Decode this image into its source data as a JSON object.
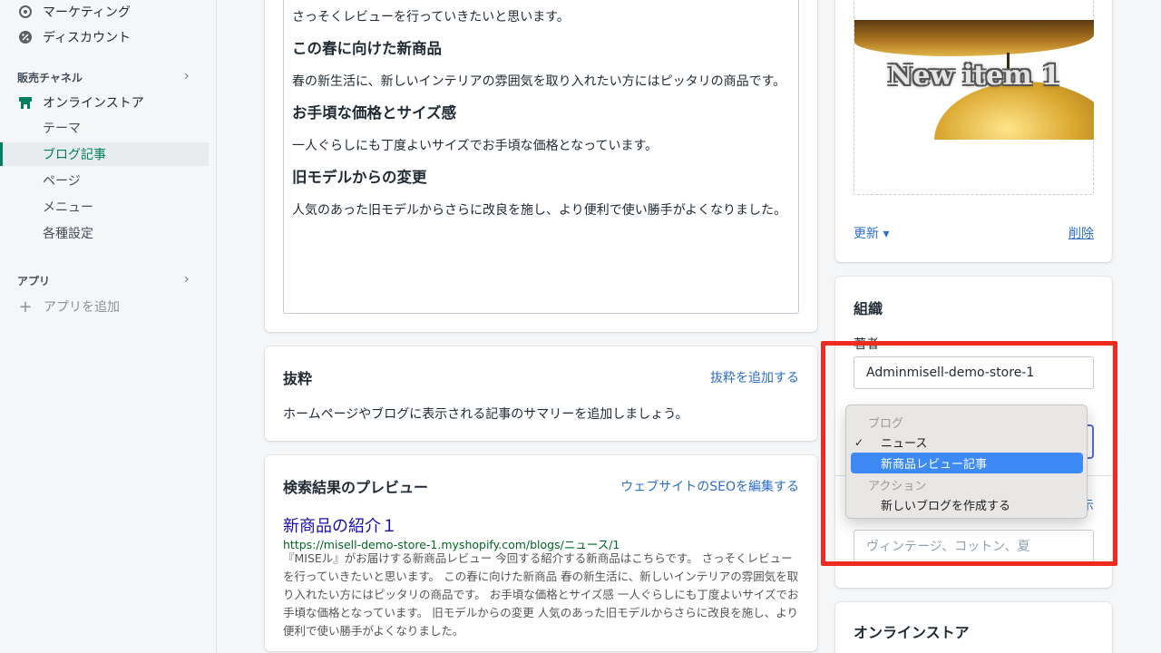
{
  "sidebar": {
    "marketing": "マーケティング",
    "discounts": "ディスカウント",
    "sales_channels": "販売チャネル",
    "online_store": "オンラインストア",
    "sub_items": [
      "テーマ",
      "ブログ記事",
      "ページ",
      "メニュー",
      "各種設定"
    ],
    "apps": "アプリ",
    "add_app": "アプリを追加"
  },
  "editor": {
    "p1": "さっそくレビューを行っていきたいと思います。",
    "h1": "この春に向けた新商品",
    "p2": "春の新生活に、新しいインテリアの雰囲気を取り入れたい方にはピッタリの商品です。",
    "h2": "お手頃な価格とサイズ感",
    "p3": "一人ぐらしにも丁度よいサイズでお手頃な価格となっています。",
    "h3": "旧モデルからの変更",
    "p4": "人気のあった旧モデルからさらに改良を施し、より便利で使い勝手がよくなりました。"
  },
  "excerpt": {
    "title": "抜粋",
    "add_link": "抜粋を追加する",
    "description": "ホームページやブログに表示される記事のサマリーを追加しましょう。"
  },
  "seo": {
    "title": "検索結果のプレビュー",
    "edit_link": "ウェブサイトのSEOを編集する",
    "preview_title": "新商品の紹介１",
    "preview_url": "https://misell-demo-store-1.myshopify.com/blogs/ニュース/1",
    "preview_desc": "『MISEル』がお届けする新商品レビュー 今回する紹介する新商品はこちらです。 さっそくレビューを行っていきたいと思います。 この春に向けた新商品 春の新生活に、新しいインテリアの雰囲気を取り入れたい方にはピッタリの商品です。 お手頃な価格とサイズ感 一人ぐらしにも丁度よいサイズでお手頃な価格となっています。 旧モデルからの変更 人気のあった旧モデルからさらに改良を施し、より便利で使い勝手がよくなりました。"
  },
  "image": {
    "overlay_text": "New item 1",
    "update": "更新 ▾",
    "delete": "削除"
  },
  "organization": {
    "title": "組織",
    "author_label": "著者",
    "author_value": "Adminmisell-demo-store-1",
    "tags_link": "示",
    "tags_placeholder": "ヴィンテージ、コットン、夏"
  },
  "online_store_card": {
    "title": "オンラインストア"
  },
  "dropdown": {
    "group_blog": "ブログ",
    "items": [
      "ニュース",
      "新商品レビュー記事"
    ],
    "check": "✓",
    "group_action": "アクション",
    "action_item": "新しいブログを作成する"
  },
  "colors": {
    "accent_green": "#008060",
    "link_blue": "#2c6ecb",
    "highlight": "#3d8af7",
    "annotation_red": "#ee2b1f"
  }
}
